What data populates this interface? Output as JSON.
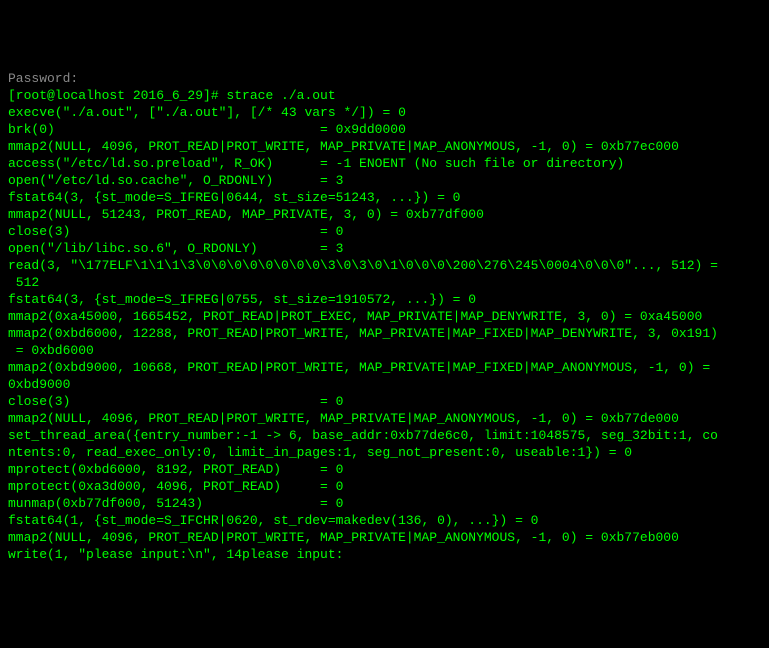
{
  "terminal": {
    "lines": [
      "Password:",
      "[root@localhost 2016_6_29]# strace ./a.out",
      "execve(\"./a.out\", [\"./a.out\"], [/* 43 vars */]) = 0",
      "brk(0)                                  = 0x9dd0000",
      "mmap2(NULL, 4096, PROT_READ|PROT_WRITE, MAP_PRIVATE|MAP_ANONYMOUS, -1, 0) = 0xb77ec000",
      "access(\"/etc/ld.so.preload\", R_OK)      = -1 ENOENT (No such file or directory)",
      "open(\"/etc/ld.so.cache\", O_RDONLY)      = 3",
      "fstat64(3, {st_mode=S_IFREG|0644, st_size=51243, ...}) = 0",
      "mmap2(NULL, 51243, PROT_READ, MAP_PRIVATE, 3, 0) = 0xb77df000",
      "close(3)                                = 0",
      "open(\"/lib/libc.so.6\", O_RDONLY)        = 3",
      "read(3, \"\\177ELF\\1\\1\\1\\3\\0\\0\\0\\0\\0\\0\\0\\0\\3\\0\\3\\0\\1\\0\\0\\0\\200\\276\\245\\0004\\0\\0\\0\"..., 512) = 512",
      "fstat64(3, {st_mode=S_IFREG|0755, st_size=1910572, ...}) = 0",
      "mmap2(0xa45000, 1665452, PROT_READ|PROT_EXEC, MAP_PRIVATE|MAP_DENYWRITE, 3, 0) = 0xa45000",
      "mmap2(0xbd6000, 12288, PROT_READ|PROT_WRITE, MAP_PRIVATE|MAP_FIXED|MAP_DENYWRITE, 3, 0x191) = 0xbd6000",
      "mmap2(0xbd9000, 10668, PROT_READ|PROT_WRITE, MAP_PRIVATE|MAP_FIXED|MAP_ANONYMOUS, -1, 0) = 0xbd9000",
      "close(3)                                = 0",
      "mmap2(NULL, 4096, PROT_READ|PROT_WRITE, MAP_PRIVATE|MAP_ANONYMOUS, -1, 0) = 0xb77de000",
      "set_thread_area({entry_number:-1 -> 6, base_addr:0xb77de6c0, limit:1048575, seg_32bit:1, contents:0, read_exec_only:0, limit_in_pages:1, seg_not_present:0, useable:1}) = 0",
      "mprotect(0xbd6000, 8192, PROT_READ)     = 0",
      "mprotect(0xa3d000, 4096, PROT_READ)     = 0",
      "munmap(0xb77df000, 51243)               = 0",
      "fstat64(1, {st_mode=S_IFCHR|0620, st_rdev=makedev(136, 0), ...}) = 0",
      "mmap2(NULL, 4096, PROT_READ|PROT_WRITE, MAP_PRIVATE|MAP_ANONYMOUS, -1, 0) = 0xb77eb000",
      "write(1, \"please input:\\n\", 14please input:"
    ]
  }
}
